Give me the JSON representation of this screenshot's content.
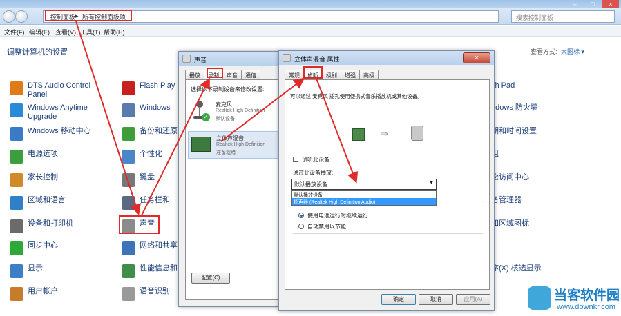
{
  "explorer": {
    "breadcrumb": [
      "控制面板",
      "所有控制面板项"
    ],
    "search_placeholder": "搜索控制面板",
    "menu": [
      "文件(F)",
      "编辑(E)",
      "查看(V)",
      "工具(T)",
      "帮助(H)"
    ],
    "page_title": "调整计算机的设置",
    "view_by_label": "查看方式:",
    "view_mode": "大图标 ▾"
  },
  "items_col1": [
    {
      "label": "DTS Audio Control Panel",
      "icon": "audio-control-icon",
      "color": "#e07b1a"
    },
    {
      "label": "Windows Anytime Upgrade",
      "icon": "windows-flag-icon",
      "color": "#2b8ad8"
    },
    {
      "label": "Windows 移动中心",
      "icon": "mobility-center-icon",
      "color": "#3a7ac7"
    },
    {
      "label": "电源选项",
      "icon": "power-options-icon",
      "color": "#3c9e3c"
    },
    {
      "label": "家长控制",
      "icon": "parental-control-icon",
      "color": "#d08a2a"
    },
    {
      "label": "区域和语言",
      "icon": "globe-icon",
      "color": "#2f7fc9"
    },
    {
      "label": "设备和打印机",
      "icon": "printer-icon",
      "color": "#6b6b6b"
    },
    {
      "label": "同步中心",
      "icon": "sync-icon",
      "color": "#2fa83a"
    },
    {
      "label": "显示",
      "icon": "display-icon",
      "color": "#3d7fc4"
    },
    {
      "label": "用户帐户",
      "icon": "user-accounts-icon",
      "color": "#c77b2d"
    }
  ],
  "items_col2": [
    {
      "label": "Flash Play",
      "icon": "flash-icon",
      "color": "#c8201c"
    },
    {
      "label": "Windows",
      "icon": "windows-icon",
      "color": "#5a7bb0"
    },
    {
      "label": "备份和还原",
      "icon": "backup-icon",
      "color": "#3f9e3a"
    },
    {
      "label": "个性化",
      "icon": "personalize-icon",
      "color": "#4c86c9"
    },
    {
      "label": "键盘",
      "icon": "keyboard-icon",
      "color": "#777777"
    },
    {
      "label": "任务栏和",
      "icon": "taskbar-icon",
      "color": "#5b6a80"
    },
    {
      "label": "声音",
      "icon": "speaker-icon",
      "color": "#8b8b8b"
    },
    {
      "label": "网络和共享",
      "icon": "network-icon",
      "color": "#3d74b8"
    },
    {
      "label": "性能信息和",
      "icon": "performance-icon",
      "color": "#3f8f4a"
    },
    {
      "label": "语音识别",
      "icon": "microphone-icon",
      "color": "#9a9a9a"
    }
  ],
  "items_col3": [
    {
      "label": "ch Pad",
      "icon": "touchpad-icon"
    },
    {
      "label": "ndows 防火墙",
      "icon": "firewall-icon"
    },
    {
      "label": "期和时间设置",
      "icon": "clock-icon"
    },
    {
      "label": "组",
      "icon": "homegroup-icon"
    },
    {
      "label": "松访问中心",
      "icon": "access-icon"
    },
    {
      "label": "备管理器",
      "icon": "device-manager-icon"
    },
    {
      "label": "知区域图标",
      "icon": "notify-icon"
    },
    {
      "label": "",
      "icon": "blank-icon"
    },
    {
      "label": "序(X) 核选显示",
      "icon": "program-icon"
    },
    {
      "label": "",
      "icon": "blank-icon"
    }
  ],
  "sound_dialog": {
    "title": "声音",
    "tabs": [
      "播放",
      "录制",
      "声音",
      "通信"
    ],
    "instruction": "选择以下录制设备来修改设置:",
    "devices": [
      {
        "name": "麦克风",
        "driver": "Realtek High Definition",
        "status": "默认设备"
      },
      {
        "name": "立体声混音",
        "driver": "Realtek High Definition",
        "status": "准备就绪"
      }
    ],
    "configure_button": "配置(C)"
  },
  "props_dialog": {
    "title": "立体声混音 属性",
    "tabs": [
      "常规",
      "侦听",
      "级别",
      "增强",
      "高级"
    ],
    "description": "可以通过 麦克风 插孔使用便携式音乐播放机或其他设备。",
    "listen_checkbox": "侦听此设备",
    "playback_label": "通过此设备播放:",
    "combo_value": "默认播放设备",
    "dropdown_options": [
      "默认播放设备",
      "扬声器 (Realtek High Definition Audio)"
    ],
    "power_options": [
      "使用电池运行时继续运行",
      "自动禁用以节能"
    ],
    "buttons": [
      "确定",
      "取消",
      "应用(A)"
    ]
  },
  "watermark": {
    "brand": "当客软件园",
    "url": "www.downkr.com"
  },
  "colors": {
    "annotation": "#e02b2b",
    "link": "#1c3e7a",
    "selection": "#3399ff"
  }
}
